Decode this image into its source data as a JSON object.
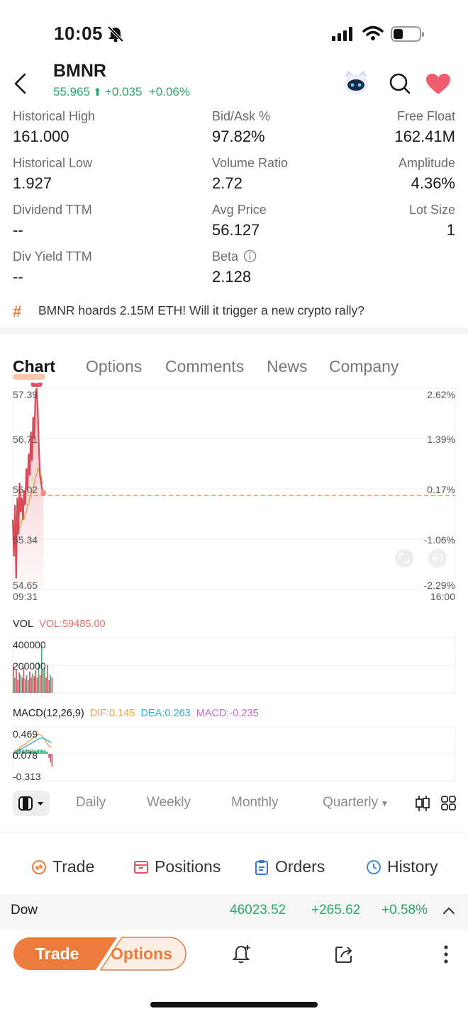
{
  "status_bar": {
    "time": "10:05"
  },
  "header": {
    "ticker": "BMNR",
    "price": "55.965",
    "change": "+0.035",
    "change_pct": "+0.06%"
  },
  "stats": [
    {
      "label": "Historical High",
      "value": "161.000"
    },
    {
      "label": "Bid/Ask %",
      "value": "97.82%"
    },
    {
      "label": "Free Float",
      "value": "162.41M"
    },
    {
      "label": "Historical Low",
      "value": "1.927"
    },
    {
      "label": "Volume Ratio",
      "value": "2.72"
    },
    {
      "label": "Amplitude",
      "value": "4.36%"
    },
    {
      "label": "Dividend TTM",
      "value": "--"
    },
    {
      "label": "Avg Price",
      "value": "56.127"
    },
    {
      "label": "Lot Size",
      "value": "1"
    },
    {
      "label": "Div Yield TTM",
      "value": "--"
    },
    {
      "label": "Beta",
      "value": "2.128"
    }
  ],
  "topic": {
    "text": "BMNR hoards 2.15M ETH! Will it trigger a new crypto rally?"
  },
  "tabs": [
    "Chart",
    "Options",
    "Comments",
    "News",
    "Company"
  ],
  "chart": {
    "price_axis": [
      "57.39",
      "56.71",
      "56.02",
      "55.34",
      "54.65"
    ],
    "pct_axis": [
      "2.62%",
      "1.39%",
      "0.17%",
      "-1.06%",
      "-2.29%"
    ],
    "time_start": "09:31",
    "time_end": "16:00",
    "signal_badge": "S",
    "line_color": "#d94a57",
    "avg_color": "#e8a04a"
  },
  "chart_data": {
    "type": "line",
    "x": [
      "09:31",
      "09:32",
      "09:33",
      "09:34",
      "09:35",
      "09:36",
      "09:37",
      "09:38",
      "09:39",
      "09:40",
      "09:41",
      "09:42",
      "09:43",
      "09:44",
      "09:45",
      "09:46",
      "09:47",
      "09:48",
      "09:49",
      "09:50",
      "09:51",
      "09:52",
      "09:53",
      "09:54",
      "09:55",
      "09:56",
      "09:57",
      "09:58"
    ],
    "series": [
      {
        "values": [
          55.6,
          55.1,
          55.8,
          54.8,
          55.9,
          55.4,
          56.1,
          55.7,
          55.9,
          55.6,
          56.0,
          55.8,
          56.3,
          56.0,
          56.5,
          56.2,
          56.8,
          56.4,
          57.0,
          56.7,
          57.3,
          57.39,
          57.1,
          56.6,
          56.2,
          56.1,
          56.0,
          55.965
        ]
      },
      {
        "values": [
          55.6,
          55.4,
          55.5,
          55.3,
          55.4,
          55.4,
          55.5,
          55.5,
          55.6,
          55.6,
          55.6,
          55.7,
          55.7,
          55.8,
          55.8,
          55.9,
          55.9,
          56.0,
          56.0,
          56.1,
          56.2,
          56.2,
          56.3,
          56.3,
          56.2,
          56.2,
          56.1,
          56.1
        ]
      }
    ],
    "ylim": [
      54.65,
      57.39
    ],
    "reference": 55.93
  },
  "volume": {
    "title": "VOL",
    "value_label": "VOL:59485.00",
    "axis": [
      "400000",
      "200000"
    ]
  },
  "macd": {
    "title": "MACD(12,26,9)",
    "dif": "DIF:0.145",
    "dea": "DEA:0.263",
    "macd": "MACD:-0.235",
    "axis": [
      "0.469",
      "0.078",
      "-0.313"
    ],
    "dif_color": "#e8a04a",
    "dea_color": "#3ea7d6",
    "macd_color": "#c46ad0"
  },
  "periods": [
    "Daily",
    "Weekly",
    "Monthly",
    "Quarterly"
  ],
  "actions": [
    "Trade",
    "Positions",
    "Orders",
    "History"
  ],
  "index": {
    "name": "Dow",
    "value": "46023.52",
    "change": "+265.62",
    "change_pct": "+0.58%"
  },
  "bottom": {
    "trade": "Trade",
    "options": "Options"
  },
  "accent": "#ec7b3c"
}
